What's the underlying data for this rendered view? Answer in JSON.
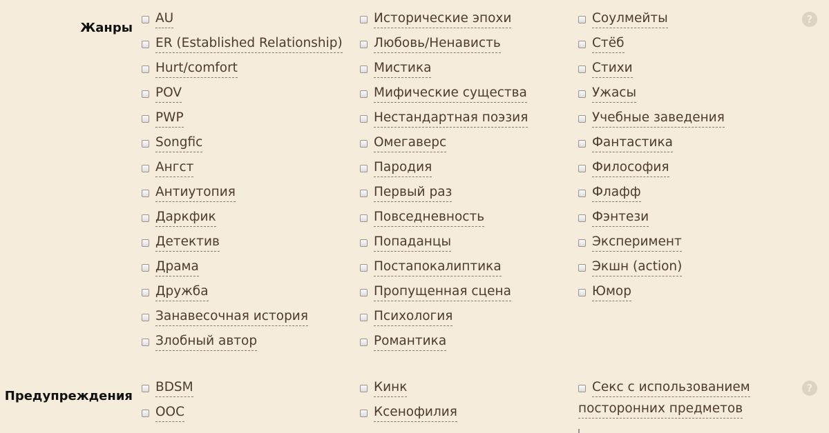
{
  "genres": {
    "label": "Жанры",
    "help_icon": "question-circle-icon",
    "columns": [
      [
        "AU",
        "ER (Established Relationship)",
        "Hurt/comfort",
        "POV",
        "PWP",
        "Songfic",
        "Ангст",
        "Антиутопия",
        "Даркфик",
        "Детектив",
        "Драма",
        "Дружба",
        "Занавесочная история",
        "Злобный автор"
      ],
      [
        "Исторические эпохи",
        "Любовь/Ненависть",
        "Мистика",
        "Мифические существа",
        "Нестандартная поэзия",
        "Омегаверс",
        "Пародия",
        "Первый раз",
        "Повседневность",
        "Попаданцы",
        "Постапокалиптика",
        "Пропущенная сцена",
        "Психология",
        "Романтика"
      ],
      [
        "Соулмейты",
        "Стёб",
        "Стихи",
        "Ужасы",
        "Учебные заведения",
        "Фантастика",
        "Философия",
        "Флафф",
        "Фэнтези",
        "Эксперимент",
        "Экшн (action)",
        "Юмор"
      ]
    ]
  },
  "warnings": {
    "label": "Предупреждения",
    "help_icon": "question-circle-icon",
    "col1": [
      "BDSM",
      "OOC"
    ],
    "col2": [
      "Кинк",
      "Ксенофилия"
    ],
    "col3_item": {
      "line1": "Секс с использованием",
      "line2": "посторонних предметов"
    }
  }
}
